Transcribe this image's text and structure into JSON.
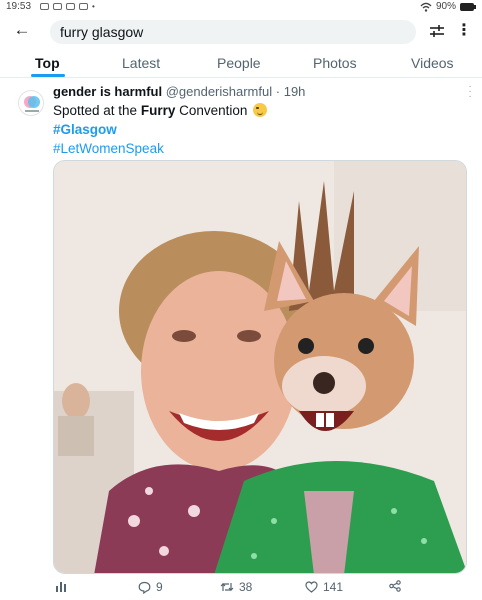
{
  "status_bar": {
    "time": "19:53",
    "battery": "90%"
  },
  "search": {
    "query": "furry glasgow"
  },
  "tabs": [
    {
      "label": "Top"
    },
    {
      "label": "Latest"
    },
    {
      "label": "People"
    },
    {
      "label": "Photos"
    },
    {
      "label": "Videos"
    }
  ],
  "tweet": {
    "display_name": "gender is harmful",
    "handle": "@genderisharmful",
    "separator": "·",
    "timestamp": "19h",
    "text_prefix": "Spotted at the ",
    "text_bold": "Furry",
    "text_suffix": " Convention ",
    "hashtag_1": "#Glasgow",
    "hashtag_2": "#LetWomenSpeak",
    "stats": {
      "replies": "9",
      "retweets": "38",
      "likes": "141"
    }
  },
  "icons": {
    "back": "arrow-left-icon",
    "filter": "sliders-icon",
    "more": "vertical-dots-icon",
    "analytics": "bar-chart-icon",
    "reply": "speech-bubble-icon",
    "retweet": "retweet-icon",
    "like": "heart-icon",
    "share": "share-icon"
  },
  "colors": {
    "accent": "#1d9bf0",
    "text": "#0f1419",
    "muted": "#536471"
  }
}
